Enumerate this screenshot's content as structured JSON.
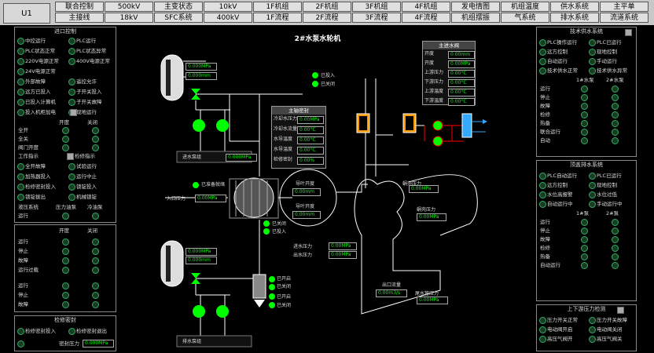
{
  "unit_label": "U1",
  "nav_row1": [
    "联合控制",
    "500kV",
    "主变状态",
    "10kV",
    "1F机组",
    "2F机组",
    "3F机组",
    "4F机组",
    "发电情图",
    "机组温度",
    "供水系统",
    "主平单"
  ],
  "nav_row2": [
    "主接线",
    "18kV",
    "SFC系统",
    "400kV",
    "1F流程",
    "2F流程",
    "3F流程",
    "4F流程",
    "机组摆振",
    "气系统",
    "排水系统",
    "流道系统"
  ],
  "page_title": "2#水泵水轮机",
  "left_panels": {
    "p1": {
      "title": "进口控制",
      "rows": [
        [
          "中控运行",
          "PLC运行"
        ],
        [
          "PLC状态正常",
          "PLC状态异常"
        ],
        [
          "220V电源正常",
          "400V电源正常"
        ],
        [
          "24V电源正常",
          ""
        ],
        [
          "外部故障",
          "遥控允许"
        ],
        [
          "远方已投入",
          "子开关投入"
        ],
        [
          "已投入计算机",
          "子开关故障"
        ],
        [
          "投入机柜加电",
          "现地运行"
        ]
      ],
      "subhead": [
        "",
        "开度",
        "关闭"
      ],
      "rows2": [
        "全开",
        "全关",
        "阀门开度"
      ],
      "rows3_label": "工作指示",
      "rows3_right": "检修指示",
      "rows3": [
        [
          "全开故障",
          "试验运行"
        ],
        [
          "加热器投入",
          "运行中止"
        ],
        [
          "检修密封投入",
          "锁锭投入"
        ],
        [
          "锁锭拔出",
          "机械锁锭"
        ]
      ],
      "rows4": [
        "液压系统"
      ],
      "subhead2": [
        "",
        "压力油泵",
        "冷油泵"
      ],
      "rows5": [
        "运行",
        "停止",
        "故障",
        "运行过载"
      ]
    },
    "p2": {
      "subhead": [
        "",
        "开度",
        "关闭"
      ],
      "rows": [
        "运行",
        "停止",
        "故障",
        "运行过载"
      ]
    },
    "p3": {
      "title": "检修密封",
      "rows": [
        [
          "检修密封投入",
          "检修密封退出"
        ],
        [
          "密封压力"
        ]
      ],
      "pressure_value": "0.000MPa"
    }
  },
  "center": {
    "top_pump": {
      "p1": "0.000MPa",
      "p2": "0.000mm"
    },
    "bot_pump": {
      "p1": "0.000MPa",
      "p2": "0.000mm"
    },
    "tank_label": "进水泵组",
    "tank_value": "0.000MPa",
    "tank2_label": "排水泵组",
    "valve_labels": [
      "已投入",
      "已关闭"
    ],
    "inlet_label": "入口压力",
    "inlet_value": "0.00MPa",
    "unit_ready": "已准备就绪",
    "guide": {
      "l1": "导叶开度",
      "v1": "0.00mm",
      "l2": "导叶开度",
      "v2": "0.00mm"
    },
    "spiral": {
      "l1": "蜗壳压力",
      "v1": "0.00MPa",
      "l2": "蜗壳压力",
      "v2": "0.00MPa"
    },
    "valves_right": [
      "已关闭",
      "已投入"
    ],
    "bottom_valves": [
      "已开启",
      "已关闭"
    ],
    "bottom_valves2": [
      "已开启",
      "已关闭"
    ],
    "left_mid_labels": {
      "a": "进水压力",
      "b": "出水压力"
    },
    "left_mid_values": {
      "a": "0.00MPa",
      "b": "0.00MPa"
    },
    "pipe_box": {
      "l1": "出口流量",
      "v1": "0.00m3/s",
      "l2": "尾水压力",
      "v2": "0.00MPa"
    },
    "flow_bottom": {
      "l1": "尾水管压力",
      "v1": "0.00MPa",
      "l2": "尾水管压力",
      "v2": "0.00MPa"
    }
  },
  "info_panel_1": {
    "title": "主进水阀",
    "rows": [
      [
        "开度",
        ""
      ],
      [
        "开度",
        "0.00%"
      ],
      [
        "上游压力",
        "0.00MPa"
      ],
      [
        "下游压力",
        "0.00MPa"
      ],
      [
        "上游温度",
        "0.0°C"
      ],
      [
        "下游温度",
        "0.0°C"
      ]
    ],
    "values": [
      "0.00mm",
      "0.00MPa",
      "0.00°C",
      "0.00°C",
      "0.00°C",
      "0.00°C"
    ]
  },
  "info_panel_2": {
    "title": "主轴密封",
    "rows": [
      "冷却水压力",
      "冷却水流量",
      "水导温度",
      "水导温度",
      "检修密封"
    ],
    "values": [
      "0.00MPa",
      "0.00°C",
      "0.00°C",
      "0.00°C",
      "0.00%"
    ]
  },
  "right_panels": {
    "p1": {
      "title": "技术供水系统",
      "rows": [
        [
          "PLC操作运行",
          "PLC已运行"
        ],
        [
          "远方控制",
          "现地控制"
        ],
        [
          "自动运行",
          "手动运行"
        ],
        [
          "技术供水正常",
          "技术供水异常"
        ]
      ],
      "subhead": [
        "",
        "1#水泵",
        "2#水泵"
      ],
      "rows2": [
        "运行",
        "停止",
        "故障",
        "检修",
        "热备",
        "联合运行",
        "自动"
      ]
    },
    "p2": {
      "title": "顶盖排水系统",
      "rows": [
        [
          "PLC自动运行",
          "PLC已运行"
        ],
        [
          "远方控制",
          "现地控制"
        ],
        [
          "水位高报警",
          "水位过低"
        ],
        [
          "自动运行中",
          "手动运行中"
        ]
      ],
      "subhead": [
        "",
        "1#泵",
        "2#泵"
      ],
      "rows2": [
        "运行",
        "停止",
        "故障",
        "检修",
        "热备",
        "自动运行"
      ]
    },
    "p3": {
      "title": "上下游压力检测",
      "rows": [
        [
          "压力开关正常",
          "压力开关故障"
        ],
        [
          "电动阀开启",
          "电动阀关闭"
        ],
        [
          "高压气阀开",
          "高压气阀关"
        ]
      ]
    }
  }
}
